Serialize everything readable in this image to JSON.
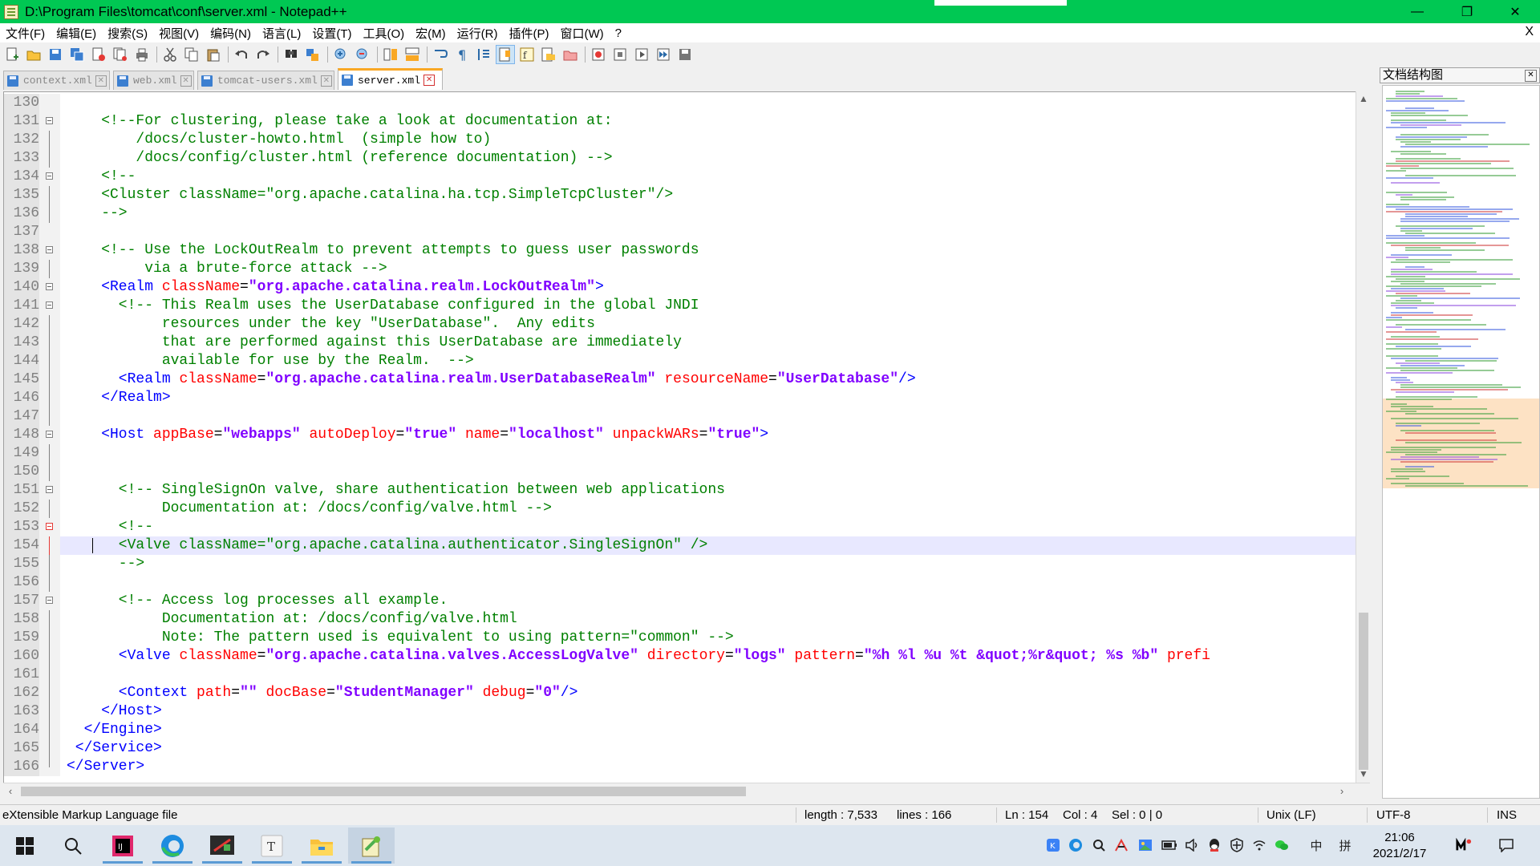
{
  "window": {
    "title": "D:\\Program Files\\tomcat\\conf\\server.xml - Notepad++",
    "minimize": "—",
    "maximize": "❐",
    "close": "✕"
  },
  "menu": [
    "文件(F)",
    "编辑(E)",
    "搜索(S)",
    "视图(V)",
    "编码(N)",
    "语言(L)",
    "设置(T)",
    "工具(O)",
    "宏(M)",
    "运行(R)",
    "插件(P)",
    "窗口(W)",
    "?"
  ],
  "menu_close": "X",
  "toolbar_icons": [
    "new-file-icon",
    "open-file-icon",
    "save-icon",
    "save-all-icon",
    "close-icon",
    "close-all-icon",
    "print-icon",
    "cut-icon",
    "copy-icon",
    "paste-icon",
    "undo-icon",
    "redo-icon",
    "find-icon",
    "replace-icon",
    "zoom-in-icon",
    "zoom-out-icon",
    "sync-vertical-icon",
    "sync-horizontal-icon",
    "word-wrap-icon",
    "show-all-chars-icon",
    "indent-guide-icon",
    "doc-map-icon",
    "function-list-icon",
    "folder-workspace-icon",
    "monitoring-icon",
    "record-macro-icon",
    "stop-record-icon",
    "play-macro-icon",
    "run-macro-multiple-icon",
    "save-macro-icon"
  ],
  "tabs": [
    {
      "label": "context.xml",
      "active": false
    },
    {
      "label": "web.xml",
      "active": false
    },
    {
      "label": "tomcat-users.xml",
      "active": false
    },
    {
      "label": "server.xml",
      "active": true
    }
  ],
  "editor": {
    "lines": [
      {
        "n": "130",
        "fold": "",
        "tokens": []
      },
      {
        "n": "131",
        "fold": "box",
        "tokens": [
          [
            "cmt",
            "    <!--For clustering, please take a look at documentation at:"
          ]
        ]
      },
      {
        "n": "132",
        "fold": "line",
        "tokens": [
          [
            "cmt",
            "        /docs/cluster-howto.html  (simple how to)"
          ]
        ]
      },
      {
        "n": "133",
        "fold": "line",
        "tokens": [
          [
            "cmt",
            "        /docs/config/cluster.html (reference documentation) -->"
          ]
        ]
      },
      {
        "n": "134",
        "fold": "box",
        "tokens": [
          [
            "cmt",
            "    <!--"
          ]
        ]
      },
      {
        "n": "135",
        "fold": "line",
        "tokens": [
          [
            "cmt",
            "    <Cluster className=\"org.apache.catalina.ha.tcp.SimpleTcpCluster\"/>"
          ]
        ]
      },
      {
        "n": "136",
        "fold": "line",
        "tokens": [
          [
            "cmt",
            "    -->"
          ]
        ]
      },
      {
        "n": "137",
        "fold": "",
        "tokens": []
      },
      {
        "n": "138",
        "fold": "box",
        "tokens": [
          [
            "cmt",
            "    <!-- Use the LockOutRealm to prevent attempts to guess user passwords"
          ]
        ]
      },
      {
        "n": "139",
        "fold": "line",
        "tokens": [
          [
            "cmt",
            "         via a brute-force attack -->"
          ]
        ]
      },
      {
        "n": "140",
        "fold": "box",
        "tokens": [
          [
            "tag",
            "    <Realm "
          ],
          [
            "attr",
            "className"
          ],
          [
            "eq",
            "="
          ],
          [
            "val",
            "\"org.apache.catalina.realm.LockOutRealm\""
          ],
          [
            "tag",
            ">"
          ]
        ]
      },
      {
        "n": "141",
        "fold": "box",
        "tokens": [
          [
            "cmt",
            "      <!-- This Realm uses the UserDatabase configured in the global JNDI"
          ]
        ]
      },
      {
        "n": "142",
        "fold": "line",
        "tokens": [
          [
            "cmt",
            "           resources under the key \"UserDatabase\".  Any edits"
          ]
        ]
      },
      {
        "n": "143",
        "fold": "line",
        "tokens": [
          [
            "cmt",
            "           that are performed against this UserDatabase are immediately"
          ]
        ]
      },
      {
        "n": "144",
        "fold": "line",
        "tokens": [
          [
            "cmt",
            "           available for use by the Realm.  -->"
          ]
        ]
      },
      {
        "n": "145",
        "fold": "line",
        "tokens": [
          [
            "tag",
            "      <Realm "
          ],
          [
            "attr",
            "className"
          ],
          [
            "eq",
            "="
          ],
          [
            "val",
            "\"org.apache.catalina.realm.UserDatabaseRealm\""
          ],
          [
            "eq",
            " "
          ],
          [
            "attr",
            "resourceName"
          ],
          [
            "eq",
            "="
          ],
          [
            "val",
            "\"UserDatabase\""
          ],
          [
            "tag",
            "/>"
          ]
        ]
      },
      {
        "n": "146",
        "fold": "line",
        "tokens": [
          [
            "tag",
            "    </Realm>"
          ]
        ]
      },
      {
        "n": "147",
        "fold": "line",
        "tokens": []
      },
      {
        "n": "148",
        "fold": "box",
        "tokens": [
          [
            "tag",
            "    <Host "
          ],
          [
            "attr",
            "appBase"
          ],
          [
            "eq",
            "="
          ],
          [
            "val",
            "\"webapps\""
          ],
          [
            "eq",
            " "
          ],
          [
            "attr",
            "autoDeploy"
          ],
          [
            "eq",
            "="
          ],
          [
            "val",
            "\"true\""
          ],
          [
            "eq",
            " "
          ],
          [
            "attr",
            "name"
          ],
          [
            "eq",
            "="
          ],
          [
            "val",
            "\"localhost\""
          ],
          [
            "eq",
            " "
          ],
          [
            "attr",
            "unpackWARs"
          ],
          [
            "eq",
            "="
          ],
          [
            "val",
            "\"true\""
          ],
          [
            "tag",
            ">"
          ]
        ]
      },
      {
        "n": "149",
        "fold": "line",
        "tokens": []
      },
      {
        "n": "150",
        "fold": "line",
        "tokens": []
      },
      {
        "n": "151",
        "fold": "box",
        "tokens": [
          [
            "cmt",
            "      <!-- SingleSignOn valve, share authentication between web applications"
          ]
        ]
      },
      {
        "n": "152",
        "fold": "line",
        "tokens": [
          [
            "cmt",
            "           Documentation at: /docs/config/valve.html -->"
          ]
        ]
      },
      {
        "n": "153",
        "fold": "redbox",
        "tokens": [
          [
            "cmt",
            "      <!--"
          ]
        ]
      },
      {
        "n": "154",
        "fold": "redline",
        "current": true,
        "tokens": [
          [
            "cmt",
            "      <Valve className=\"org.apache.catalina.authenticator.SingleSignOn\" />"
          ]
        ]
      },
      {
        "n": "155",
        "fold": "line",
        "tokens": [
          [
            "cmt",
            "      -->"
          ]
        ]
      },
      {
        "n": "156",
        "fold": "line",
        "tokens": []
      },
      {
        "n": "157",
        "fold": "box",
        "tokens": [
          [
            "cmt",
            "      <!-- Access log processes all example."
          ]
        ]
      },
      {
        "n": "158",
        "fold": "line",
        "tokens": [
          [
            "cmt",
            "           Documentation at: /docs/config/valve.html"
          ]
        ]
      },
      {
        "n": "159",
        "fold": "line",
        "tokens": [
          [
            "cmt",
            "           Note: The pattern used is equivalent to using pattern=\"common\" -->"
          ]
        ]
      },
      {
        "n": "160",
        "fold": "line",
        "tokens": [
          [
            "tag",
            "      <Valve "
          ],
          [
            "attr",
            "className"
          ],
          [
            "eq",
            "="
          ],
          [
            "val",
            "\"org.apache.catalina.valves.AccessLogValve\""
          ],
          [
            "eq",
            " "
          ],
          [
            "attr",
            "directory"
          ],
          [
            "eq",
            "="
          ],
          [
            "val",
            "\"logs\""
          ],
          [
            "eq",
            " "
          ],
          [
            "attr",
            "pattern"
          ],
          [
            "eq",
            "="
          ],
          [
            "val",
            "\"%h %l %u %t &quot;%r&quot; %s %b\""
          ],
          [
            "eq",
            " "
          ],
          [
            "attr",
            "prefi"
          ]
        ]
      },
      {
        "n": "161",
        "fold": "line",
        "tokens": []
      },
      {
        "n": "162",
        "fold": "line",
        "tokens": [
          [
            "tag",
            "      <Context "
          ],
          [
            "attr",
            "path"
          ],
          [
            "eq",
            "="
          ],
          [
            "val",
            "\"\""
          ],
          [
            "eq",
            " "
          ],
          [
            "attr",
            "docBase"
          ],
          [
            "eq",
            "="
          ],
          [
            "val",
            "\"StudentManager\""
          ],
          [
            "eq",
            " "
          ],
          [
            "attr",
            "debug"
          ],
          [
            "eq",
            "="
          ],
          [
            "val",
            "\"0\""
          ],
          [
            "tag",
            "/>"
          ]
        ]
      },
      {
        "n": "163",
        "fold": "line",
        "tokens": [
          [
            "tag",
            "    </Host>"
          ]
        ]
      },
      {
        "n": "164",
        "fold": "line",
        "tokens": [
          [
            "tag",
            "  </Engine>"
          ]
        ]
      },
      {
        "n": "165",
        "fold": "line",
        "tokens": [
          [
            "tag",
            " </Service>"
          ]
        ]
      },
      {
        "n": "166",
        "fold": "end",
        "tokens": [
          [
            "tag",
            "</Server>"
          ]
        ]
      }
    ]
  },
  "docmap": {
    "title": "文档结构图",
    "close": "✕"
  },
  "status": {
    "file_type": "eXtensible Markup Language file",
    "length": "length : 7,533",
    "lines": "lines : 166",
    "ln": "Ln : 154",
    "col": "Col : 4",
    "sel": "Sel : 0 | 0",
    "eol": "Unix (LF)",
    "encoding": "UTF-8",
    "mode": "INS"
  },
  "taskbar": {
    "apps": [
      "windows-start-icon",
      "search-icon",
      "intellij-icon",
      "edge-icon",
      "screenshot-tool-icon",
      "typora-icon",
      "file-explorer-icon",
      "notepadpp-icon"
    ],
    "tray": [
      "kaspersky-icon",
      "edge-tray-icon",
      "search-tray-icon",
      "pen-icon",
      "image-tray-icon",
      "battery-icon",
      "volume-icon",
      "qq-icon",
      "shield-icon",
      "wifi-icon",
      "wechat-icon",
      "ime-zh-icon",
      "ime-grid-icon"
    ],
    "ime_zh": "中",
    "ime_grid": "拼",
    "time": "21:06",
    "date": "2021/2/17",
    "notifications_icon": "notification-icon"
  },
  "colors": {
    "titlebar": "#00c853",
    "comment": "#008000",
    "tag": "#0000ff",
    "attr": "#ff0000",
    "value": "#8000ff",
    "active_tab_accent": "#f9a825"
  }
}
